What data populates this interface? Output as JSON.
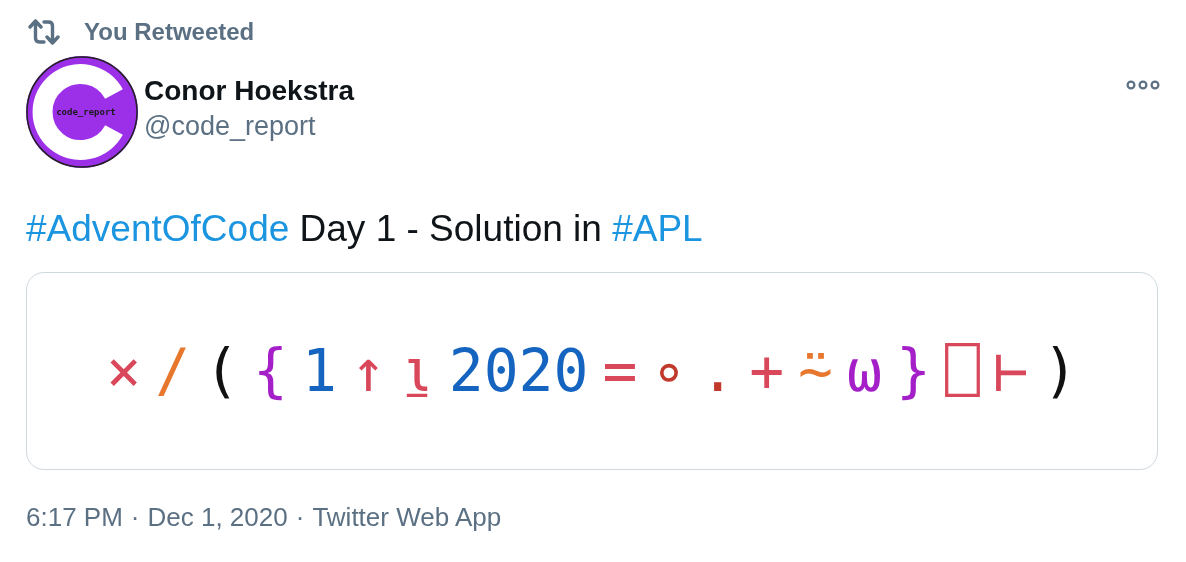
{
  "retweet_label": "You Retweeted",
  "author": {
    "avatar_label": "code_report",
    "name": "Conor Hoekstra",
    "handle": "@code_report"
  },
  "tweet_text": [
    {
      "kind": "hashtag",
      "text": "#AdventOfCode"
    },
    {
      "kind": "plain",
      "text": " Day 1 - Solution in "
    },
    {
      "kind": "hashtag",
      "text": "#APL"
    }
  ],
  "code_tokens": [
    {
      "text": "×",
      "color": "#d9475a"
    },
    {
      "text": "/",
      "color": "#e8772e"
    },
    {
      "text": "(",
      "color": "#111111"
    },
    {
      "text": "{",
      "color": "#a51fc9"
    },
    {
      "text": "1",
      "color": "#1565c0"
    },
    {
      "text": "↑",
      "color": "#d9475a"
    },
    {
      "text": "⍸",
      "color": "#d9475a"
    },
    {
      "text": "2020",
      "color": "#1565c0"
    },
    {
      "text": "=",
      "color": "#d9475a"
    },
    {
      "text": "∘",
      "color": "#c0392b"
    },
    {
      "text": ".",
      "color": "#c0392b"
    },
    {
      "text": "+",
      "color": "#d9475a"
    },
    {
      "text": "⍨",
      "color": "#e8772e"
    },
    {
      "text": "⍵",
      "color": "#a51fc9"
    },
    {
      "text": "}",
      "color": "#a51fc9"
    },
    {
      "text": "⎕",
      "color": "#d9475a"
    },
    {
      "text": "⊢",
      "color": "#d9475a"
    },
    {
      "text": ")",
      "color": "#111111"
    }
  ],
  "footer": [
    "6:17 PM",
    "·",
    "Dec 1, 2020",
    "·",
    "Twitter Web App"
  ]
}
